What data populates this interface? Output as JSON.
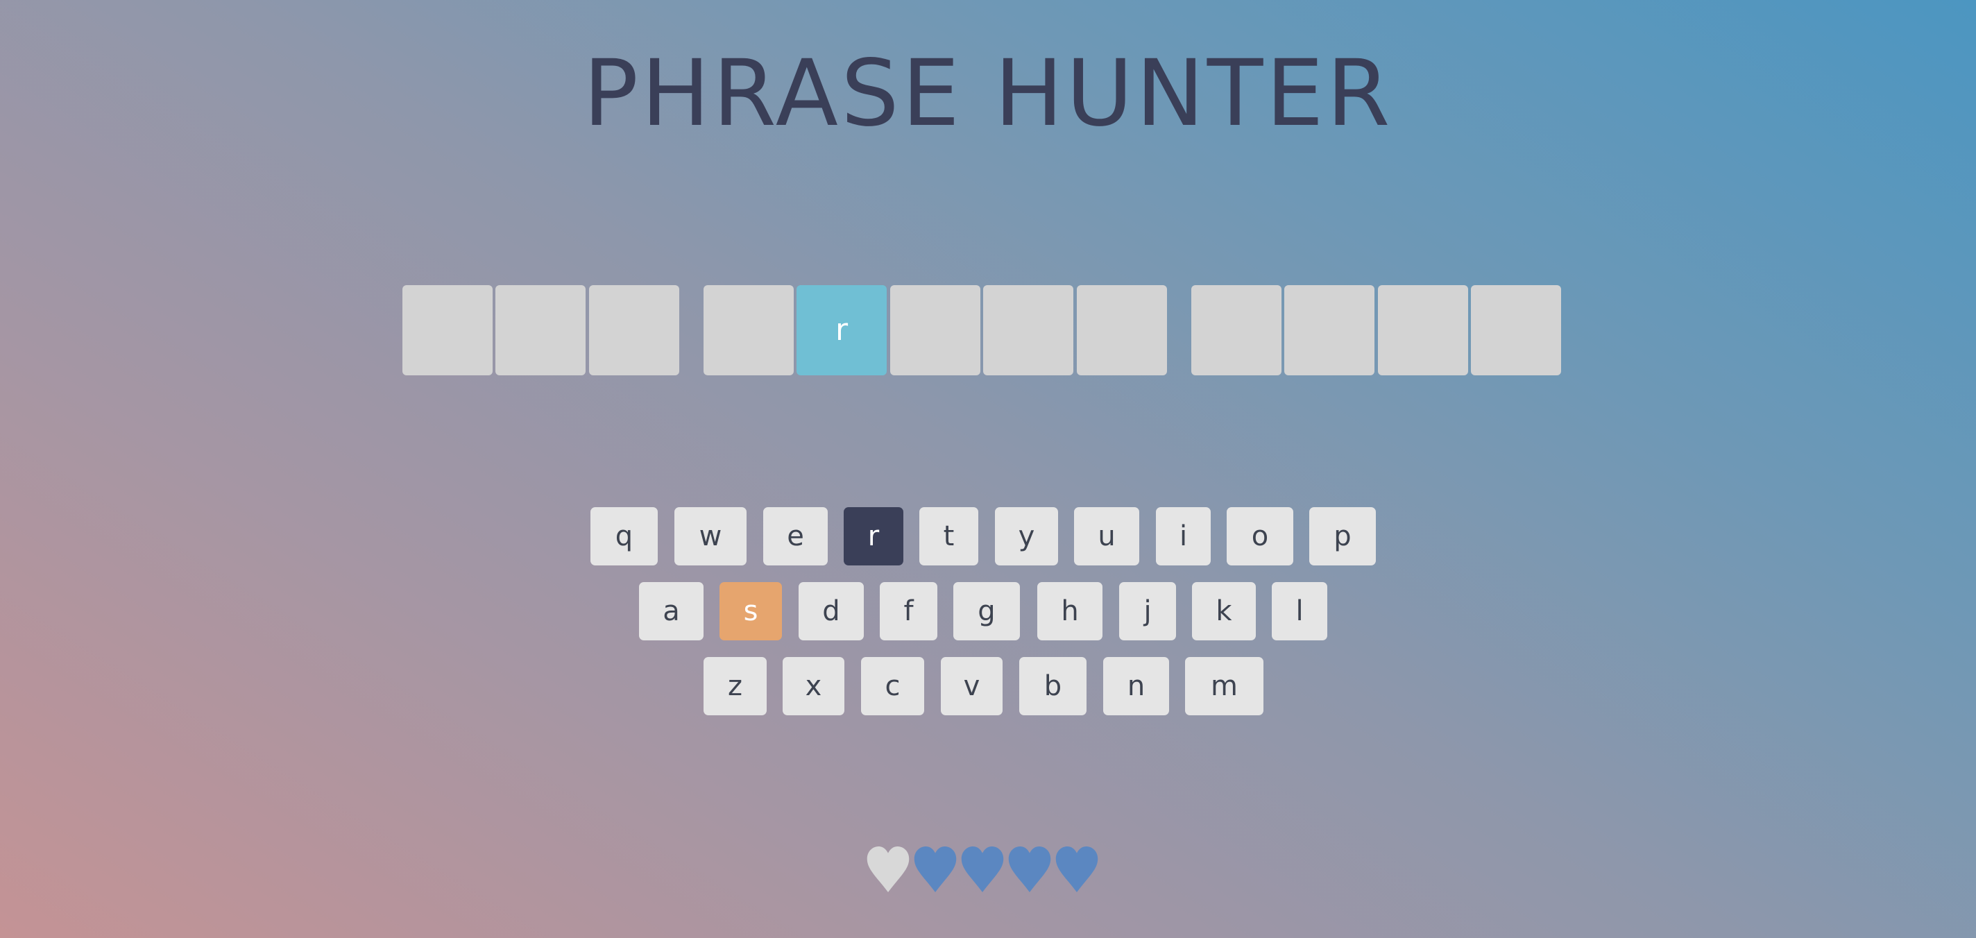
{
  "title": "PHRASE HUNTER",
  "phrase": {
    "letters": [
      "",
      "",
      "",
      "",
      "r",
      "",
      "",
      "",
      "",
      "",
      "",
      ""
    ],
    "shown": [
      false,
      false,
      false,
      false,
      true,
      false,
      false,
      false,
      false,
      false,
      false,
      false
    ]
  },
  "keyboard": {
    "row1": [
      "q",
      "w",
      "e",
      "r",
      "t",
      "y",
      "u",
      "i",
      "o",
      "p"
    ],
    "row2": [
      "a",
      "s",
      "d",
      "f",
      "g",
      "h",
      "j",
      "k",
      "l"
    ],
    "row3": [
      "z",
      "x",
      "c",
      "v",
      "b",
      "n",
      "m"
    ],
    "chosen": [
      "r"
    ],
    "wrong": [
      "s"
    ]
  },
  "lives": {
    "total": 5,
    "lost": 1
  },
  "colors": {
    "title": "#3a3f58",
    "tile_hidden": "#d3d3d3",
    "tile_shown": "#70bfd4",
    "key_default": "#e5e5e5",
    "key_chosen": "#3a3f58",
    "key_wrong": "#e6a56e",
    "heart_live": "#5b87c1",
    "heart_lost": "#d8d8d8"
  },
  "icons": {
    "heart": "heart-icon"
  }
}
